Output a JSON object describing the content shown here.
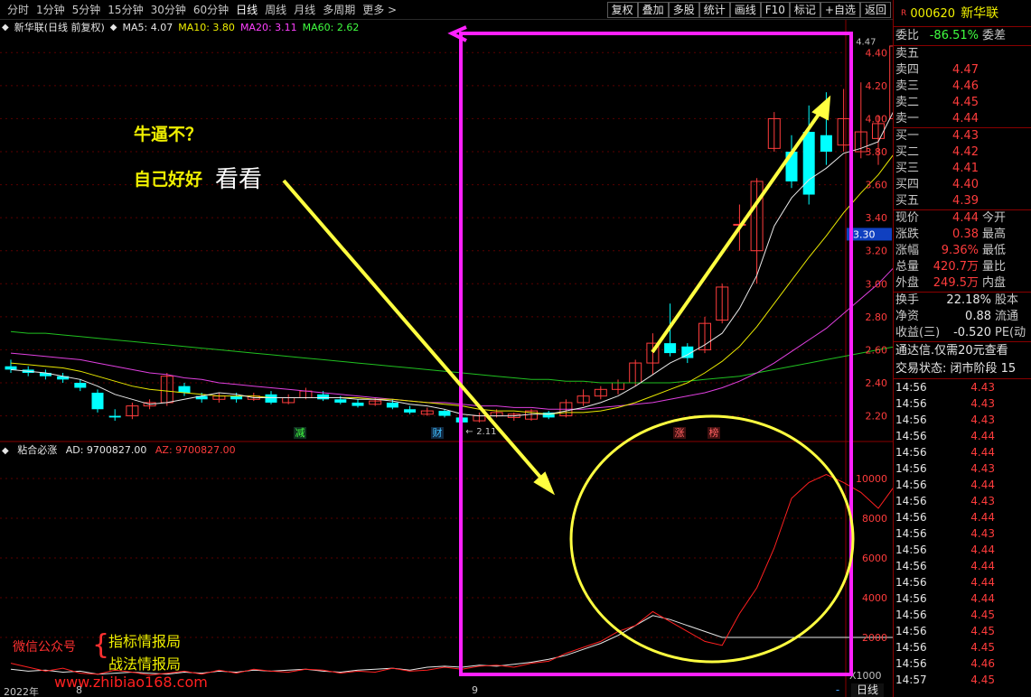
{
  "toolbar": {
    "periods": [
      "分时",
      "1分钟",
      "5分钟",
      "15分钟",
      "30分钟",
      "60分钟",
      "日线",
      "周线",
      "月线",
      "多周期",
      "更多 >"
    ],
    "active_period": "日线",
    "actions": [
      "复权",
      "叠加",
      "多股",
      "统计",
      "画线",
      "F10",
      "标记",
      "+自选",
      "返回"
    ]
  },
  "main_info": {
    "title": "新华联(日线 前复权)",
    "ma5": "MA5: 4.07",
    "ma10": "MA10: 3.80",
    "ma20": "MA20: 3.11",
    "ma60": "MA60: 2.62"
  },
  "sub_info": {
    "title": "粘合必涨",
    "ad": "AD: 9700827.00",
    "az": "AZ: 9700827.00"
  },
  "price_axis": [
    "4.40",
    "4.20",
    "4.00",
    "3.80",
    "3.60",
    "3.40",
    "3.20",
    "3.00",
    "2.80",
    "2.60",
    "2.40",
    "2.20"
  ],
  "sub_axis": [
    "10000",
    "8000",
    "6000",
    "4000",
    "2000"
  ],
  "current_price_tag": "3.30",
  "sub_scale": "X1000",
  "high_label": "4.47",
  "low_label": "2.11",
  "markers": {
    "cai": "财",
    "jian": "减",
    "zhang": "涨",
    "bang": "榜"
  },
  "annotations": {
    "line1": "牛逼不？",
    "line2": "自己好好",
    "line2b": "看看"
  },
  "watermark": {
    "wechat": "微信公众号",
    "item1": "指标情报局",
    "item2": "战法情报局",
    "site": "www.zhibiao168.com"
  },
  "time_axis": {
    "year": "2022年",
    "m8": "8",
    "m9": "9"
  },
  "buttons": {
    "daily": "日线",
    "minus": "-"
  },
  "stock": {
    "badge": "R",
    "code": "000620",
    "name": "新华联"
  },
  "ratio": {
    "label": "委比",
    "value": "-86.51%",
    "right": "委差"
  },
  "sell": [
    {
      "label": "卖五",
      "price": ""
    },
    {
      "label": "卖四",
      "price": "4.47"
    },
    {
      "label": "卖三",
      "price": "4.46"
    },
    {
      "label": "卖二",
      "price": "4.45"
    },
    {
      "label": "卖一",
      "price": "4.44"
    }
  ],
  "buy": [
    {
      "label": "买一",
      "price": "4.43"
    },
    {
      "label": "买二",
      "price": "4.42"
    },
    {
      "label": "买三",
      "price": "4.41"
    },
    {
      "label": "买四",
      "price": "4.40"
    },
    {
      "label": "买五",
      "price": "4.39"
    }
  ],
  "quote": [
    {
      "label": "现价",
      "value": "4.44",
      "right": "今开"
    },
    {
      "label": "涨跌",
      "value": "0.38",
      "right": "最高"
    },
    {
      "label": "涨幅",
      "value": "9.36%",
      "right": "最低"
    },
    {
      "label": "总量",
      "value": "420.7万",
      "right": "量比"
    },
    {
      "label": "外盘",
      "value": "249.5万",
      "right": "内盘"
    }
  ],
  "fin": [
    {
      "label": "换手",
      "value": "22.18%",
      "right": "股本"
    },
    {
      "label": "净资",
      "value": "0.88",
      "right": "流通"
    },
    {
      "label": "收益(三)",
      "value": "-0.520",
      "right": "PE(动"
    }
  ],
  "notice": "通达信.仅需20元查看",
  "status": "交易状态: 闭市阶段 15",
  "ticks": [
    {
      "t": "14:56",
      "p": "4.43",
      "d": ""
    },
    {
      "t": "14:56",
      "p": "4.43",
      "d": ""
    },
    {
      "t": "14:56",
      "p": "4.43",
      "d": ""
    },
    {
      "t": "14:56",
      "p": "4.44",
      "d": ""
    },
    {
      "t": "14:56",
      "p": "4.44",
      "d": ""
    },
    {
      "t": "14:56",
      "p": "4.43",
      "d": ""
    },
    {
      "t": "14:56",
      "p": "4.44",
      "d": ""
    },
    {
      "t": "14:56",
      "p": "4.43",
      "d": ""
    },
    {
      "t": "14:56",
      "p": "4.44",
      "d": ""
    },
    {
      "t": "14:56",
      "p": "4.43",
      "d": ""
    },
    {
      "t": "14:56",
      "p": "4.44",
      "d": ""
    },
    {
      "t": "14:56",
      "p": "4.44",
      "d": ""
    },
    {
      "t": "14:56",
      "p": "4.44",
      "d": ""
    },
    {
      "t": "14:56",
      "p": "4.44",
      "d": ""
    },
    {
      "t": "14:56",
      "p": "4.45",
      "d": ""
    },
    {
      "t": "14:56",
      "p": "4.45",
      "d": ""
    },
    {
      "t": "14:56",
      "p": "4.45",
      "d": ""
    },
    {
      "t": "14:56",
      "p": "4.46",
      "d": ""
    },
    {
      "t": "14:57",
      "p": "4.45",
      "d": ""
    }
  ],
  "chart_data": {
    "type": "candlestick",
    "price_range": [
      2.05,
      4.5
    ],
    "sub_range": [
      0,
      11000
    ],
    "candles": [
      [
        2.5,
        2.48,
        2.54,
        2.46
      ],
      [
        2.48,
        2.46,
        2.5,
        2.44
      ],
      [
        2.46,
        2.44,
        2.48,
        2.42
      ],
      [
        2.44,
        2.42,
        2.46,
        2.4
      ],
      [
        2.4,
        2.37,
        2.42,
        2.35
      ],
      [
        2.34,
        2.24,
        2.36,
        2.22
      ],
      [
        2.2,
        2.19,
        2.24,
        2.17
      ],
      [
        2.2,
        2.26,
        2.28,
        2.18
      ],
      [
        2.26,
        2.28,
        2.3,
        2.24
      ],
      [
        2.28,
        2.44,
        2.46,
        2.26
      ],
      [
        2.38,
        2.34,
        2.4,
        2.32
      ],
      [
        2.32,
        2.3,
        2.34,
        2.28
      ],
      [
        2.3,
        2.32,
        2.34,
        2.28
      ],
      [
        2.32,
        2.3,
        2.34,
        2.28
      ],
      [
        2.3,
        2.32,
        2.34,
        2.29
      ],
      [
        2.33,
        2.28,
        2.35,
        2.27
      ],
      [
        2.28,
        2.31,
        2.33,
        2.27
      ],
      [
        2.31,
        2.35,
        2.37,
        2.3
      ],
      [
        2.33,
        2.3,
        2.35,
        2.29
      ],
      [
        2.3,
        2.28,
        2.32,
        2.27
      ],
      [
        2.28,
        2.26,
        2.3,
        2.25
      ],
      [
        2.27,
        2.29,
        2.31,
        2.26
      ],
      [
        2.28,
        2.25,
        2.3,
        2.24
      ],
      [
        2.24,
        2.22,
        2.26,
        2.21
      ],
      [
        2.21,
        2.23,
        2.25,
        2.2
      ],
      [
        2.23,
        2.2,
        2.24,
        2.19
      ],
      [
        2.19,
        2.16,
        2.21,
        2.11
      ],
      [
        2.17,
        2.2,
        2.22,
        2.16
      ],
      [
        2.2,
        2.22,
        2.24,
        2.19
      ],
      [
        2.19,
        2.21,
        2.22,
        2.17
      ],
      [
        2.18,
        2.23,
        2.24,
        2.17
      ],
      [
        2.22,
        2.19,
        2.23,
        2.18
      ],
      [
        2.2,
        2.28,
        2.3,
        2.19
      ],
      [
        2.28,
        2.32,
        2.36,
        2.26
      ],
      [
        2.32,
        2.36,
        2.38,
        2.3
      ],
      [
        2.36,
        2.4,
        2.42,
        2.33
      ],
      [
        2.4,
        2.52,
        2.54,
        2.38
      ],
      [
        2.52,
        2.64,
        2.7,
        2.45
      ],
      [
        2.64,
        2.58,
        2.88,
        2.56
      ],
      [
        2.62,
        2.55,
        2.64,
        2.52
      ],
      [
        2.6,
        2.76,
        2.8,
        2.58
      ],
      [
        2.78,
        2.98,
        3.0,
        2.76
      ],
      [
        3.36,
        3.36,
        3.48,
        3.2
      ],
      [
        3.2,
        3.62,
        3.64,
        3.0
      ],
      [
        3.82,
        4.0,
        4.04,
        3.8
      ],
      [
        3.8,
        3.62,
        3.9,
        3.58
      ],
      [
        3.92,
        3.54,
        4.08,
        3.48
      ],
      [
        3.9,
        3.8,
        4.16,
        3.72
      ],
      [
        3.84,
        4.0,
        4.18,
        3.8
      ],
      [
        3.8,
        3.92,
        4.22,
        3.76
      ],
      [
        3.88,
        3.97,
        4.02,
        3.72
      ],
      [
        4.0,
        4.44,
        4.47,
        3.94
      ]
    ],
    "ma5": [
      2.48,
      2.47,
      2.46,
      2.44,
      2.42,
      2.38,
      2.33,
      2.3,
      2.27,
      2.28,
      2.3,
      2.32,
      2.34,
      2.33,
      2.31,
      2.31,
      2.31,
      2.31,
      2.31,
      2.31,
      2.3,
      2.3,
      2.29,
      2.27,
      2.26,
      2.24,
      2.21,
      2.2,
      2.2,
      2.2,
      2.21,
      2.21,
      2.23,
      2.25,
      2.28,
      2.32,
      2.38,
      2.45,
      2.52,
      2.57,
      2.63,
      2.7,
      2.85,
      3.05,
      3.35,
      3.52,
      3.63,
      3.7,
      3.79,
      3.82,
      3.86,
      4.07
    ],
    "ma10": [
      2.52,
      2.51,
      2.5,
      2.49,
      2.47,
      2.44,
      2.41,
      2.38,
      2.36,
      2.35,
      2.34,
      2.33,
      2.32,
      2.32,
      2.32,
      2.31,
      2.31,
      2.31,
      2.31,
      2.31,
      2.31,
      2.3,
      2.3,
      2.29,
      2.28,
      2.27,
      2.26,
      2.24,
      2.23,
      2.23,
      2.22,
      2.21,
      2.22,
      2.22,
      2.23,
      2.25,
      2.28,
      2.32,
      2.36,
      2.4,
      2.46,
      2.53,
      2.62,
      2.74,
      2.88,
      3.02,
      3.16,
      3.29,
      3.43,
      3.55,
      3.66,
      3.8
    ],
    "ma20": [
      2.58,
      2.57,
      2.56,
      2.55,
      2.54,
      2.52,
      2.5,
      2.48,
      2.46,
      2.45,
      2.43,
      2.42,
      2.4,
      2.39,
      2.38,
      2.37,
      2.36,
      2.35,
      2.34,
      2.33,
      2.32,
      2.31,
      2.3,
      2.29,
      2.28,
      2.28,
      2.27,
      2.26,
      2.26,
      2.25,
      2.25,
      2.24,
      2.24,
      2.24,
      2.25,
      2.26,
      2.27,
      2.28,
      2.3,
      2.32,
      2.34,
      2.37,
      2.41,
      2.46,
      2.52,
      2.59,
      2.66,
      2.73,
      2.82,
      2.91,
      3.0,
      3.11
    ],
    "ma60": [
      2.71,
      2.7,
      2.7,
      2.69,
      2.68,
      2.67,
      2.66,
      2.65,
      2.64,
      2.63,
      2.62,
      2.61,
      2.6,
      2.59,
      2.58,
      2.57,
      2.56,
      2.55,
      2.54,
      2.53,
      2.52,
      2.51,
      2.5,
      2.49,
      2.48,
      2.47,
      2.46,
      2.45,
      2.44,
      2.43,
      2.42,
      2.42,
      2.41,
      2.41,
      2.4,
      2.4,
      2.4,
      2.4,
      2.4,
      2.41,
      2.42,
      2.43,
      2.44,
      2.46,
      2.48,
      2.5,
      2.52,
      2.54,
      2.56,
      2.58,
      2.6,
      2.62
    ],
    "ad": [
      700,
      500,
      300,
      450,
      200,
      150,
      350,
      250,
      100,
      200,
      300,
      150,
      350,
      200,
      400,
      300,
      250,
      400,
      350,
      200,
      300,
      250,
      450,
      300,
      350,
      500,
      400,
      550,
      600,
      500,
      700,
      800,
      1200,
      1500,
      1800,
      2300,
      2600,
      3300,
      2800,
      2300,
      1800,
      1600,
      3200,
      4500,
      6500,
      9000,
      9800,
      10200,
      9800,
      9300,
      8500,
      9700
    ],
    "az": [
      400,
      300,
      350,
      250,
      300,
      150,
      200,
      250,
      200,
      150,
      250,
      200,
      300,
      250,
      350,
      300,
      350,
      400,
      300,
      250,
      350,
      400,
      450,
      350,
      500,
      550,
      500,
      600,
      550,
      650,
      750,
      900,
      1100,
      1400,
      1700,
      2100,
      2600,
      3100,
      2900,
      2600,
      2300,
      2000,
      2000,
      2000,
      2000,
      2000,
      2000,
      2000,
      2000,
      2000,
      2000,
      2000
    ]
  }
}
